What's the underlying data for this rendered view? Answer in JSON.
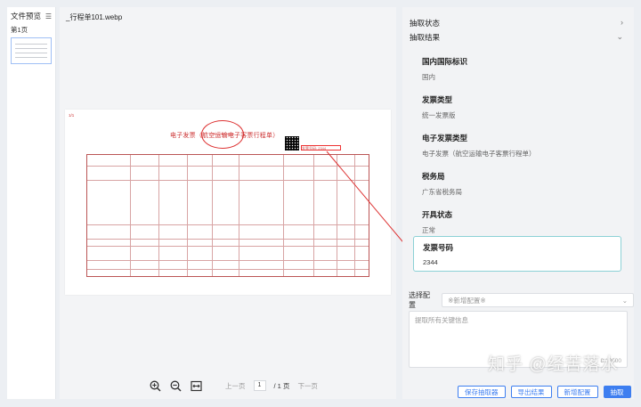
{
  "sidebar": {
    "title": "文件预览",
    "page_label": "第1页"
  },
  "center": {
    "filename": "_行程单101.webp",
    "invoice": {
      "title": "电子发票（航空运输电子客票行程单）",
      "corner": "1/1",
      "highlight": "发票号码: 2344",
      "invoice_no_value": "2344"
    },
    "pager": {
      "prev": "上一页",
      "current": "1",
      "total": "/ 1 页",
      "next": "下一页"
    }
  },
  "right": {
    "section_status": "抽取状态",
    "section_result": "抽取结果",
    "fields": [
      {
        "label": "国内国际标识",
        "value": "国内"
      },
      {
        "label": "发票类型",
        "value": "统一发票版"
      },
      {
        "label": "电子发票类型",
        "value": "电子发票（航空运输电子客票行程单）"
      },
      {
        "label": "税务局",
        "value": "广东省税务局"
      },
      {
        "label": "开具状态",
        "value": "正常"
      },
      {
        "label": "发票号码",
        "value": "2344"
      }
    ],
    "config_label": "选择配置",
    "config_placeholder": "※新增配置※",
    "textarea_placeholder": "提取所有关键信息",
    "textarea_counter": "8 / 2000",
    "buttons": {
      "save": "保存抽取器",
      "export": "导出结果",
      "add_config": "新增配置",
      "extract": "抽取"
    }
  },
  "watermark": "知乎 @经苦落水",
  "colors": {
    "accent": "#3d7ef0",
    "highlight_border": "#8cd1d6",
    "annotation": "#d33"
  }
}
